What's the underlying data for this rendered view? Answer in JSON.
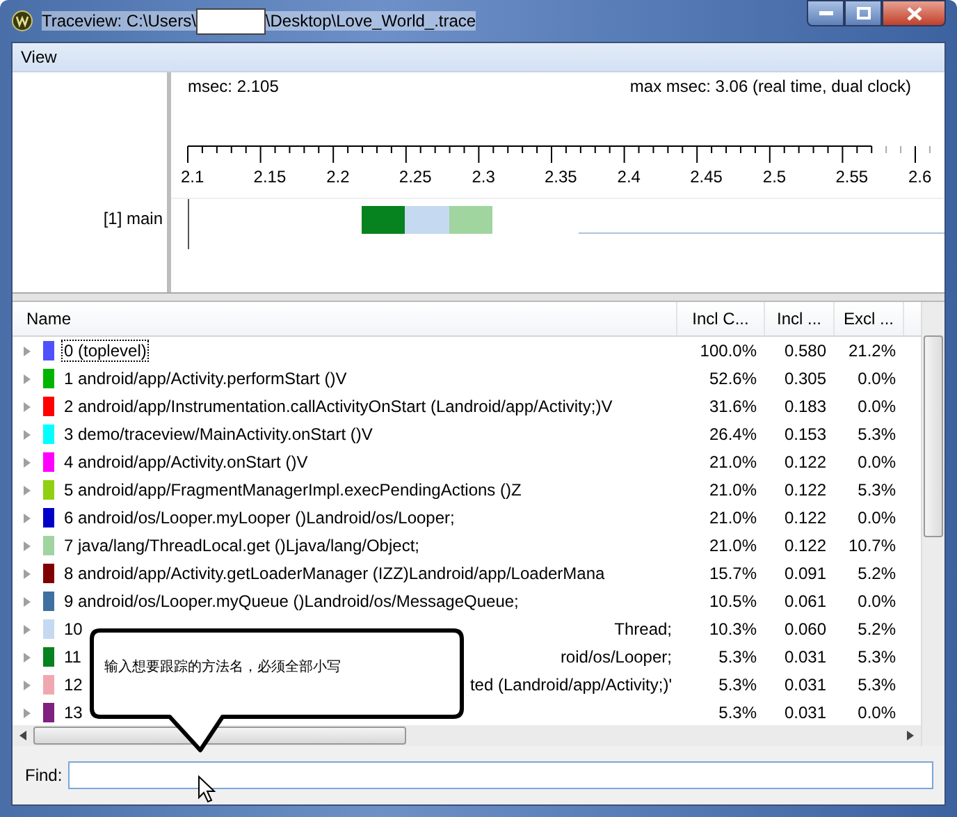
{
  "window": {
    "title_start": "Traceview: C:\\Users\\",
    "title_end": "\\Desktop\\Love_World_.trace"
  },
  "menu": [
    "View"
  ],
  "timeline": {
    "msec": "msec: 2.105",
    "max_msec": "max msec: 3.06 (real time, dual clock)",
    "ticks": [
      "2.1",
      "2.15",
      "2.2",
      "2.25",
      "2.3",
      "2.35",
      "2.4",
      "2.45",
      "2.5",
      "2.55",
      "2.6"
    ],
    "threads": [
      {
        "label": "[1] main",
        "segments": [
          {
            "color": "#06821e"
          },
          {
            "color": "#c5d9f1"
          },
          {
            "color": "#a0d5a0"
          }
        ]
      }
    ]
  },
  "table": {
    "columns": [
      "Name",
      "Incl C...",
      "Incl ...",
      "Excl ..."
    ],
    "rows": [
      {
        "color": "#5050ff",
        "focused": true,
        "cells": [
          "0 (toplevel)",
          "100.0%",
          "0.580",
          "21.2%"
        ]
      },
      {
        "color": "#00b400",
        "focused": false,
        "cells": [
          "1 android/app/Activity.performStart ()V",
          "52.6%",
          "0.305",
          "0.0%"
        ]
      },
      {
        "color": "#ff0000",
        "focused": false,
        "cells": [
          "2 android/app/Instrumentation.callActivityOnStart (Landroid/app/Activity;)V",
          "31.6%",
          "0.183",
          "0.0%"
        ]
      },
      {
        "color": "#00ffff",
        "focused": false,
        "cells": [
          "3 demo/traceview/MainActivity.onStart ()V",
          "26.4%",
          "0.153",
          "5.3%"
        ]
      },
      {
        "color": "#ff00ff",
        "focused": false,
        "cells": [
          "4 android/app/Activity.onStart ()V",
          "21.0%",
          "0.122",
          "0.0%"
        ]
      },
      {
        "color": "#90d010",
        "focused": false,
        "cells": [
          "5 android/app/FragmentManagerImpl.execPendingActions ()Z",
          "21.0%",
          "0.122",
          "5.3%"
        ]
      },
      {
        "color": "#0000c8",
        "focused": false,
        "cells": [
          "6 android/os/Looper.myLooper ()Landroid/os/Looper;",
          "21.0%",
          "0.122",
          "0.0%"
        ]
      },
      {
        "color": "#a0d4a0",
        "focused": false,
        "cells": [
          "7 java/lang/ThreadLocal.get ()Ljava/lang/Object;",
          "21.0%",
          "0.122",
          "10.7%"
        ]
      },
      {
        "color": "#800000",
        "focused": false,
        "cells": [
          "8 android/app/Activity.getLoaderManager (IZZ)Landroid/app/LoaderMana",
          "15.7%",
          "0.091",
          "5.2%"
        ]
      },
      {
        "color": "#4070a0",
        "focused": false,
        "cells": [
          "9 android/os/Looper.myQueue ()Landroid/os/MessageQueue;",
          "10.5%",
          "0.061",
          "0.0%"
        ]
      },
      {
        "name_end": "Thread;",
        "color": "#c5d9f1",
        "focused": false,
        "cells": [
          "10",
          "10.3%",
          "0.060",
          "5.2%"
        ]
      },
      {
        "name_end": "roid/os/Looper;",
        "color": "#06821e",
        "focused": false,
        "cells": [
          "11",
          "5.3%",
          "0.031",
          "5.3%"
        ]
      },
      {
        "name_end": "ted (Landroid/app/Activity;)'",
        "color": "#f0a8b0",
        "focused": false,
        "cells": [
          "12",
          "5.3%",
          "0.031",
          "5.3%"
        ]
      },
      {
        "color": "#802080",
        "focused": false,
        "cells": [
          "13",
          "5.3%",
          "0.031",
          "0.0%"
        ]
      }
    ]
  },
  "tooltip": {
    "text": "输入想要跟踪的方法名，必须全部小写"
  },
  "find": {
    "label": "Find:"
  }
}
